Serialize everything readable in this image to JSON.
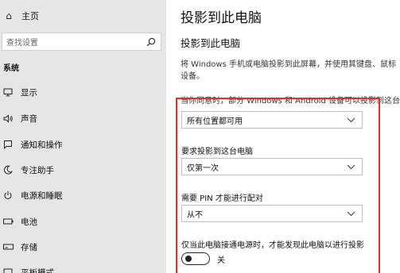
{
  "sidebar": {
    "home_label": "主页",
    "search_placeholder": "查找设置",
    "section_title": "系统",
    "items": [
      {
        "label": "显示",
        "icon": "monitor-icon"
      },
      {
        "label": "声音",
        "icon": "speaker-icon"
      },
      {
        "label": "通知和操作",
        "icon": "notification-icon"
      },
      {
        "label": "专注助手",
        "icon": "moon-icon"
      },
      {
        "label": "电源和睡眠",
        "icon": "power-icon"
      },
      {
        "label": "电池",
        "icon": "battery-icon"
      },
      {
        "label": "存储",
        "icon": "storage-icon"
      },
      {
        "label": "平板模式",
        "icon": "tablet-mode-icon"
      }
    ]
  },
  "main": {
    "title": "投影到此电脑",
    "subtitle": "投影到此电脑",
    "description_line1": "将 Windows 手机或电脑投影到此屏幕，并使用其键盘、鼠标",
    "description_line2": "设备。",
    "cut_line": "当你同意时，部分 Windows 和 Android 设备可以投影到这台",
    "setting1_value": "所有位置都可用",
    "setting2_label": "要求投影到这台电脑",
    "setting2_value": "仅第一次",
    "setting3_label": "需要 PIN 才能进行配对",
    "setting3_value": "从不",
    "setting4_label": "仅当此电脑接通电源时，才能发现此电脑以进行投影",
    "toggle_state": "关"
  },
  "colors": {
    "sidebar_bg": "#e6e6e6",
    "highlight_border": "#e1302c"
  }
}
